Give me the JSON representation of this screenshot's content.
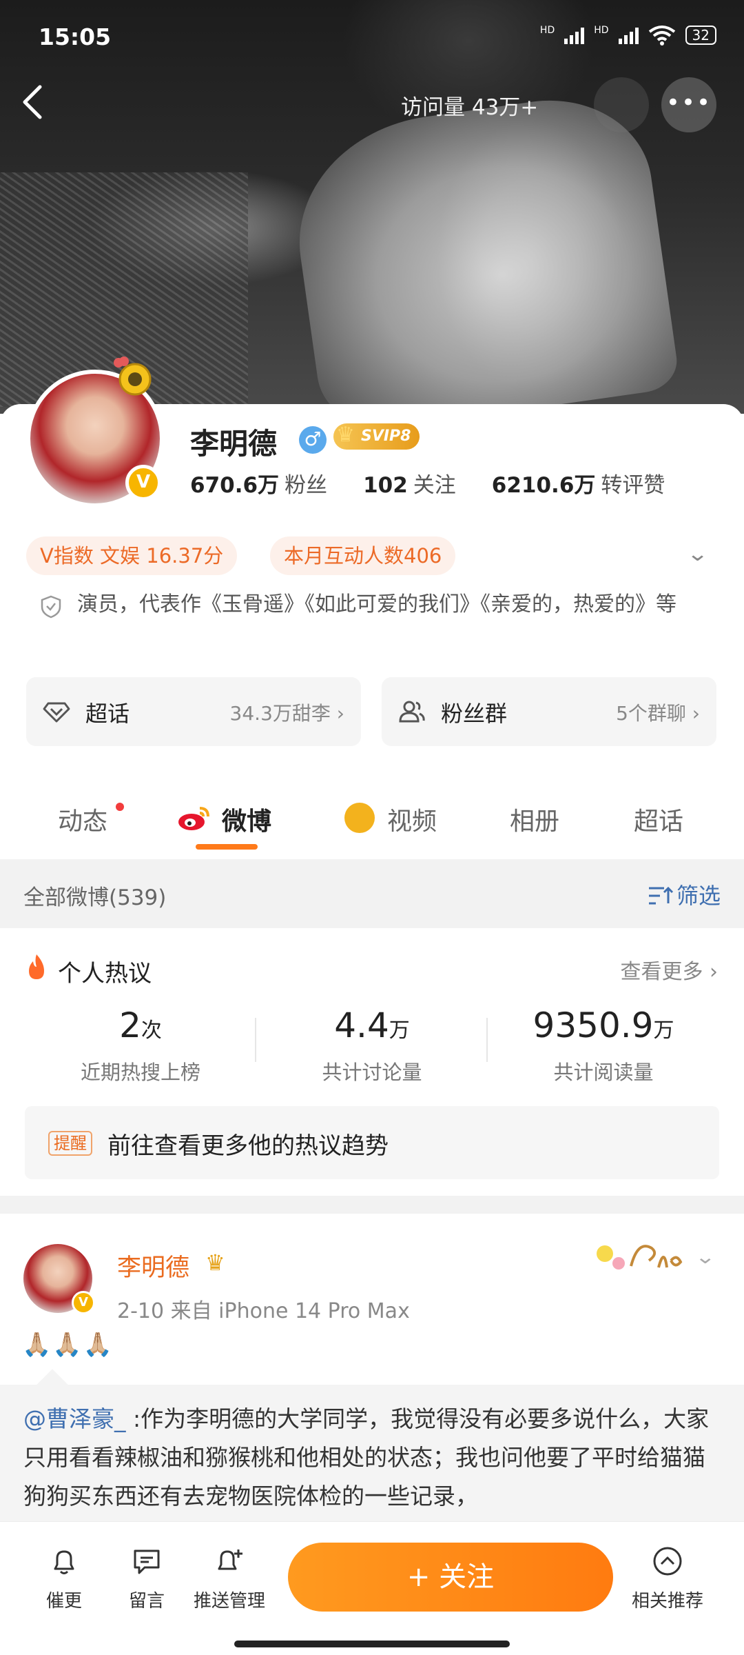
{
  "status_bar": {
    "time": "15:05",
    "battery": "32",
    "network1": "HD",
    "network2": "HD"
  },
  "nav": {
    "visits": "访问量 43万+",
    "more_icon": "more-dots-icon"
  },
  "profile": {
    "name": "李明德",
    "vip_label": "SVIP8",
    "stats": [
      {
        "num": "670.6万",
        "label": "粉丝"
      },
      {
        "num": "102",
        "label": "关注"
      },
      {
        "num": "6210.6万",
        "label": "转评赞"
      }
    ],
    "pills": [
      "V指数 文娱 16.37分",
      "本月互动人数406"
    ],
    "bio": "演员，代表作《玉骨遥》《如此可爱的我们》《亲爱的，热爱的》等",
    "supertopic": {
      "title": "超话",
      "meta": "34.3万甜李 ›"
    },
    "fangroup": {
      "title": "粉丝群",
      "meta": "5个群聊 ›"
    }
  },
  "tabs": [
    "动态",
    "微博",
    "视频",
    "相册",
    "超话"
  ],
  "filter": {
    "left": "全部微博(539)",
    "right": "筛选"
  },
  "hot": {
    "title": "个人热议",
    "see_more": "查看更多 ›",
    "metrics": [
      {
        "value": "2",
        "unit": "次",
        "label": "近期热搜上榜"
      },
      {
        "value": "4.4",
        "unit": "万",
        "label": "共计讨论量"
      },
      {
        "value": "9350.9",
        "unit": "万",
        "label": "共计阅读量"
      }
    ],
    "reminder_tag": "提醒",
    "reminder_text": "前往查看更多他的热议趋势"
  },
  "post": {
    "author": "李明德",
    "time": "2-10  来自 iPhone 14 Pro Max",
    "emoji": "🙏🏼🙏🏼🙏🏼",
    "mention": "@曹泽豪_",
    "text": " :作为李明德的大学同学，我觉得没有必要多说什么，大家只用看看辣椒油和猕猴桃和他相处的状态；我也问他要了平时给猫猫狗狗买东西还有去宠物医院体检的一些记录，"
  },
  "bottom_bar": {
    "items": [
      "催更",
      "留言",
      "推送管理",
      "相关推荐"
    ],
    "follow": "+ 关注"
  },
  "colors": {
    "accent": "#ff7b10",
    "link": "#3f6fb0",
    "orange_text": "#ea6b1f"
  }
}
